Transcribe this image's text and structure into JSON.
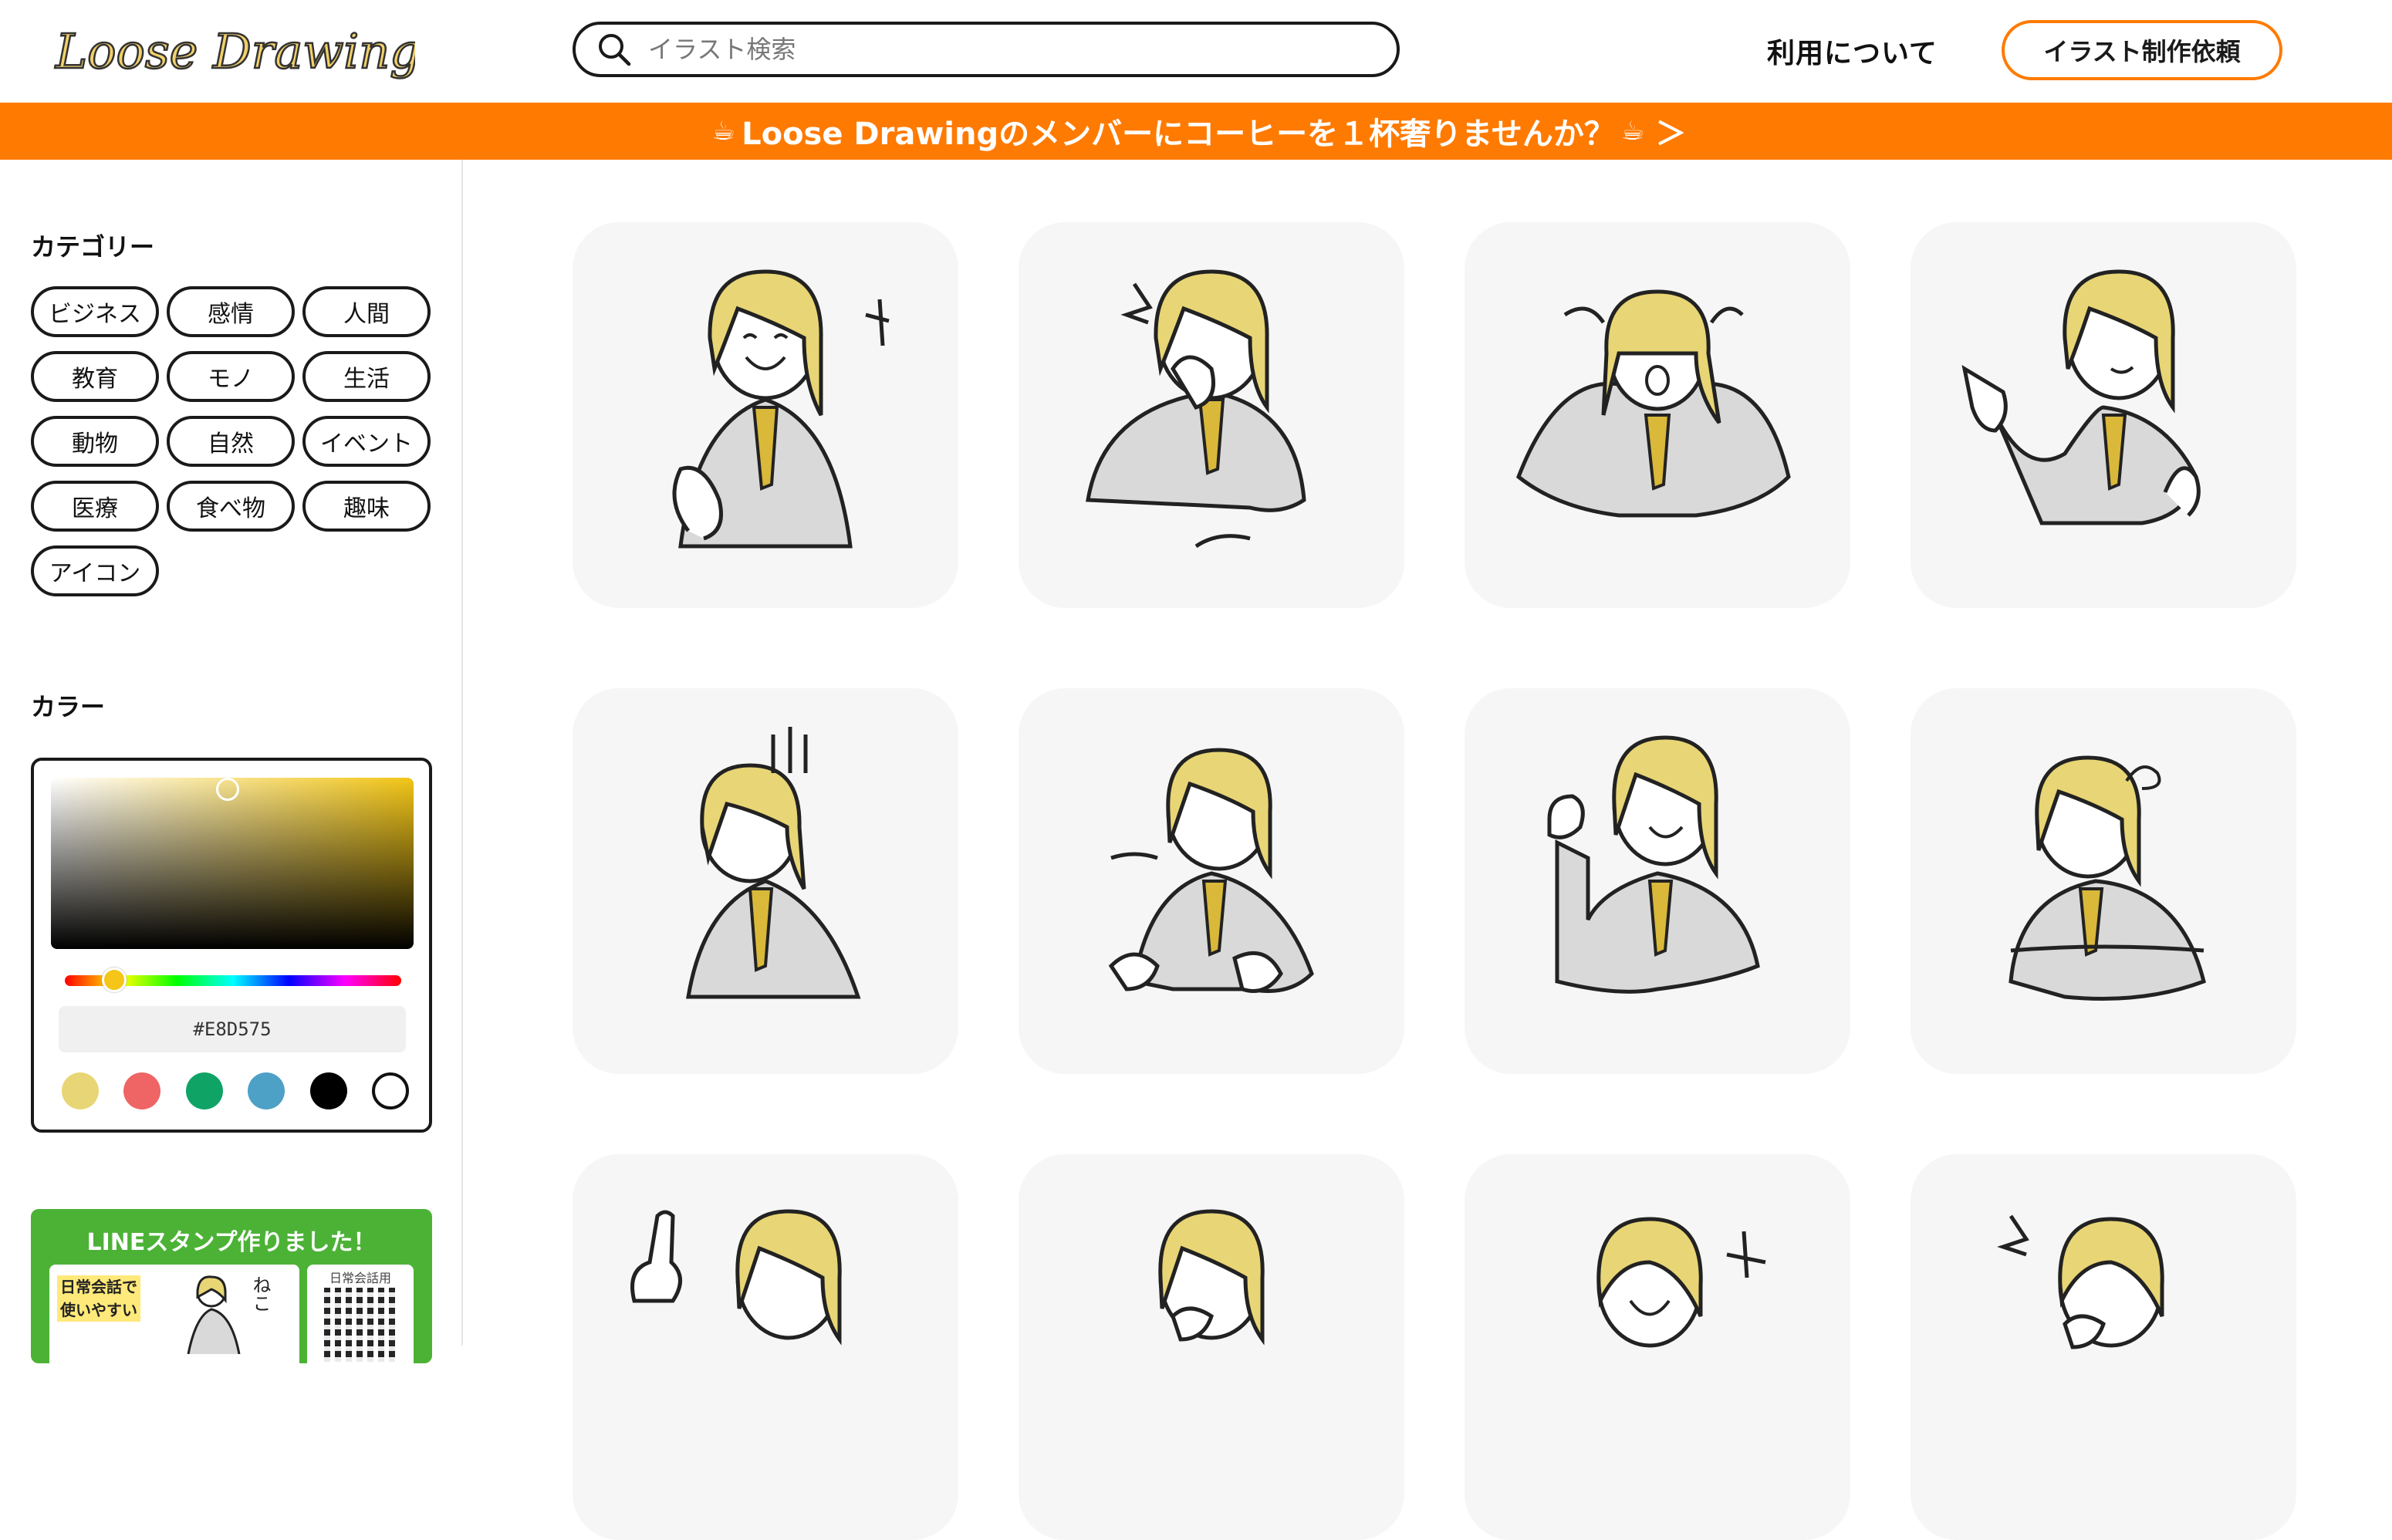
{
  "header": {
    "logo_text": "Loose Drawing",
    "search_placeholder": "イラスト検索",
    "nav_about": "利用について",
    "request_button": "イラスト制作依頼"
  },
  "banner": {
    "text": "Loose Drawingのメンバーにコーヒーを１杯奢りませんか？",
    "cup_icon": "☕",
    "arrow": "＞"
  },
  "sidebar": {
    "category_title": "カテゴリー",
    "categories": [
      "ビジネス",
      "感情",
      "人間",
      "教育",
      "モノ",
      "生活",
      "動物",
      "自然",
      "イベント",
      "医療",
      "食べ物",
      "趣味",
      "アイコン"
    ],
    "color_title": "カラー",
    "color_hex": "#E8D575",
    "swatches": [
      "#E8D575",
      "#EF6464",
      "#0FA366",
      "#4DA0C6",
      "#000000",
      "#FFFFFF"
    ],
    "line_promo": {
      "title": "LINEスタンプ作りました！",
      "image_caption_1": "日常会話で",
      "image_caption_2": "使いやすい",
      "image_side_text": "ねこ",
      "qr_label": "日常会話用"
    }
  },
  "colors": {
    "accent": "#FF7A00",
    "hair": "#E8D575",
    "suit": "#D9D9D9",
    "tie": "#D9B83A",
    "card_bg": "#F6F6F6"
  },
  "gallery": {
    "items": [
      {
        "pose": "laughing-clapping"
      },
      {
        "pose": "surprised-hand-on-mouth"
      },
      {
        "pose": "crying-holding-head"
      },
      {
        "pose": "pointing-smiling"
      },
      {
        "pose": "dismayed-shadow-lines"
      },
      {
        "pose": "sighing-fists"
      },
      {
        "pose": "cheering-fist-pump"
      },
      {
        "pose": "dizzy-arms-crossed"
      },
      {
        "pose": "index-finger-up"
      },
      {
        "pose": "thinking-hand-on-chin"
      },
      {
        "pose": "laughing-loud"
      },
      {
        "pose": "shocked-hand-on-chin"
      }
    ]
  }
}
